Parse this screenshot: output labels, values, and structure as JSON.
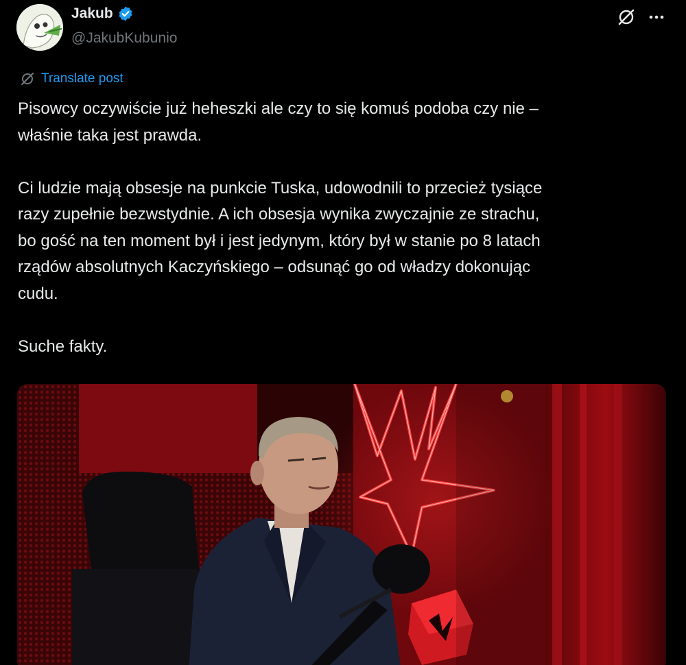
{
  "author": {
    "display_name": "Jakub",
    "handle": "@JakubKubunio",
    "verified": true,
    "avatar_icon": "avatar-image"
  },
  "actions": {
    "grok_icon": "grok-icon",
    "more_icon": "more-horizontal-icon"
  },
  "translate": {
    "label": "Translate post",
    "icon": "translate-icon"
  },
  "post": {
    "paragraphs": [
      "Pisowcy oczywiście już heheszki ale czy to się komuś podoba czy nie –\nwłaśnie taka jest prawda.",
      "Ci ludzie mają obsesje na punkcie Tuska, udowodnili to przecież tysiące\nrazy zupełnie bezwstydnie. A ich obsesja wynika zwyczajnie ze strachu,\nbo gość na ten moment był i jest jedynym, który był w stanie po 8 latach\nrządów absolutnych Kaczyńskiego – odsunąć go od władzy dokonując\ncudu.",
      "Suche fakty."
    ]
  },
  "media": {
    "kind": "video-thumbnail",
    "colors": {
      "background": "#2a0305",
      "neon": "#ff3a3a",
      "suit": "#1b2236"
    }
  },
  "colors": {
    "background": "#000000",
    "text": "#e7e9ea",
    "secondary": "#71767b",
    "link": "#1d9bf0"
  }
}
